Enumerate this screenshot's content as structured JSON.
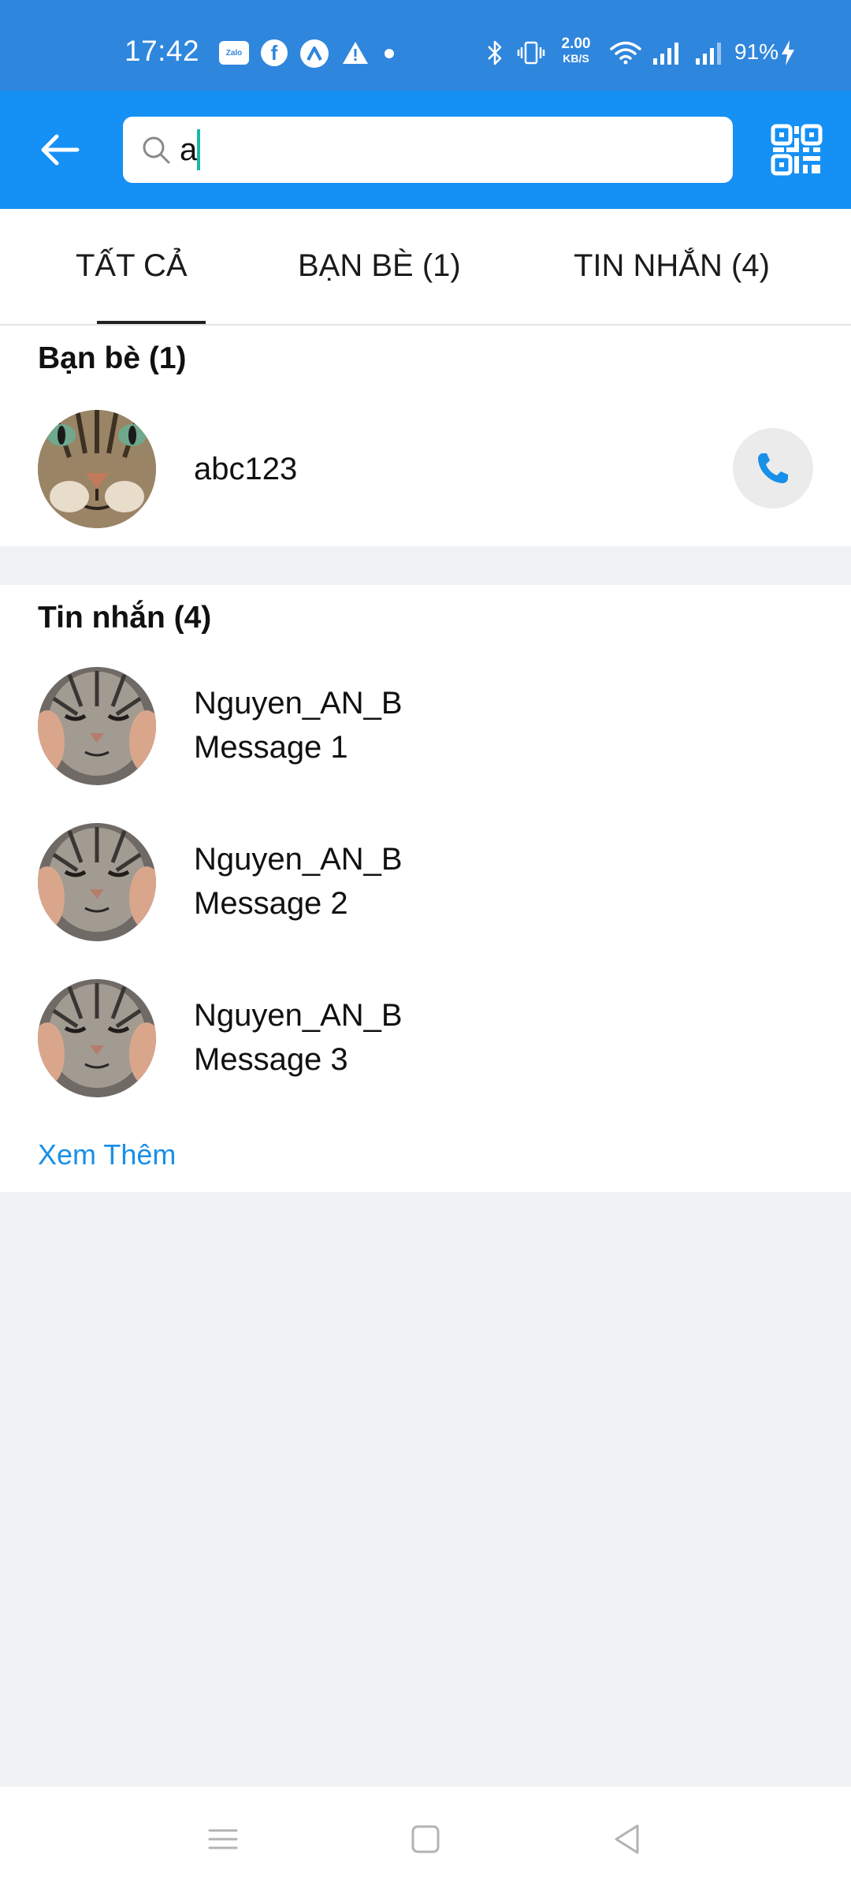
{
  "status_bar": {
    "time": "17:42",
    "zalo_icon_text": "Zalo",
    "fb_letter": "f",
    "speed_value": "2.00",
    "speed_unit": "KB/S",
    "battery": "91%",
    "icons": [
      "zalo-icon",
      "facebook-icon",
      "a-app-icon",
      "warning-icon",
      "dot-icon",
      "bluetooth-icon",
      "vibrate-icon",
      "wifi-icon",
      "signal-icon",
      "signal-icon",
      "charging-icon"
    ]
  },
  "header": {
    "search_value": "a",
    "icons": [
      "back-arrow-icon",
      "search-icon",
      "qr-code-icon"
    ]
  },
  "tabs": [
    {
      "label": "TẤT CẢ",
      "active": true
    },
    {
      "label": "BẠN BÈ (1)",
      "active": false
    },
    {
      "label": "TIN NHẮN (4)",
      "active": false
    }
  ],
  "friends": {
    "title": "Bạn bè (1)",
    "items": [
      {
        "name": "abc123",
        "action_icon": "phone-icon"
      }
    ]
  },
  "messages": {
    "title": "Tin nhắn (4)",
    "items": [
      {
        "sender": "Nguyen_AN_B",
        "text": "Message 1"
      },
      {
        "sender": "Nguyen_AN_B",
        "text": "Message 2"
      },
      {
        "sender": "Nguyen_AN_B",
        "text": "Message 3"
      }
    ],
    "more_label": "Xem Thêm"
  },
  "colors": {
    "status_bar": "#2f86dd",
    "header": "#1590f4",
    "link": "#1a8fe8",
    "caret": "#17b8a6",
    "background": "#f1f2f4"
  },
  "nav": {
    "icons": [
      "menu-icon",
      "home-square-icon",
      "back-triangle-icon"
    ]
  }
}
